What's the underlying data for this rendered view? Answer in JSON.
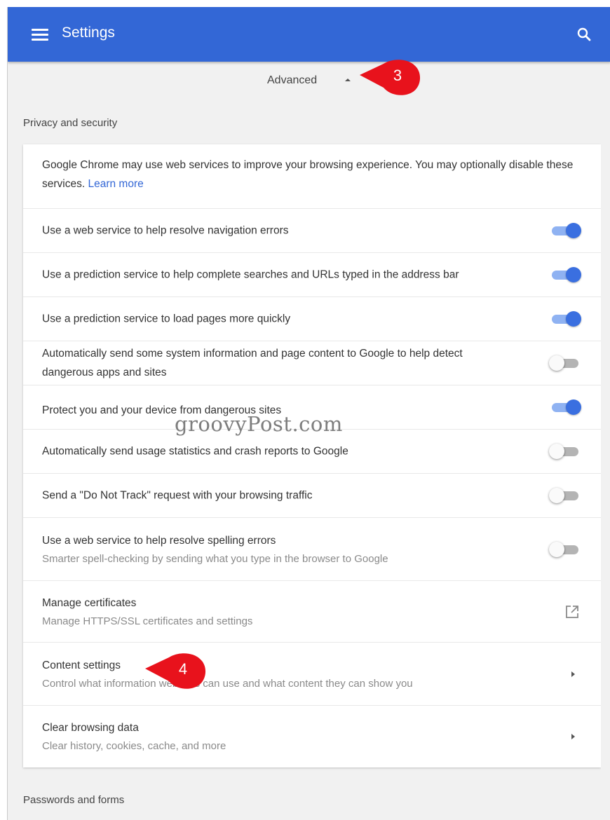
{
  "header": {
    "title": "Settings",
    "menu_icon": "hamburger-menu-icon",
    "search_icon": "search-icon",
    "color": "#3367d6"
  },
  "advanced": {
    "label": "Advanced",
    "icon": "arrow-up-icon"
  },
  "sections": {
    "privacy_title": "Privacy and security",
    "passwords_title": "Passwords and forms"
  },
  "privacy": {
    "intro_text": "Google Chrome may use web services to improve your browsing experience. You may optionally disable these services.",
    "intro_link": "Learn more",
    "toggles": [
      {
        "label": "Use a web service to help resolve navigation errors",
        "on": true
      },
      {
        "label": "Use a prediction service to help complete searches and URLs typed in the address bar",
        "on": true
      },
      {
        "label": "Use a prediction service to load pages more quickly",
        "on": true
      },
      {
        "label": "Automatically send some system information and page content to Google to help detect dangerous apps and sites",
        "on": false
      },
      {
        "label": "Protect you and your device from dangerous sites",
        "on": true
      },
      {
        "label": "Automatically send usage statistics and crash reports to Google",
        "on": false
      },
      {
        "label": "Send a \"Do Not Track\" request with your browsing traffic",
        "on": false
      },
      {
        "label": "Use a web service to help resolve spelling errors",
        "sublabel": "Smarter spell-checking by sending what you type in the browser to Google",
        "on": false
      }
    ],
    "links": [
      {
        "label": "Manage certificates",
        "sublabel": "Manage HTTPS/SSL certificates and settings",
        "icon": "open-in-new-icon"
      },
      {
        "label": "Content settings",
        "sublabel": "Control what information websites can use and what content they can show you",
        "icon": "chevron-right-icon"
      },
      {
        "label": "Clear browsing data",
        "sublabel": "Clear history, cookies, cache, and more",
        "icon": "chevron-right-icon"
      }
    ]
  },
  "watermark": "groovyPost.com",
  "annotations": [
    {
      "number": "3",
      "color": "#e8121c"
    },
    {
      "number": "4",
      "color": "#e8121c"
    }
  ]
}
